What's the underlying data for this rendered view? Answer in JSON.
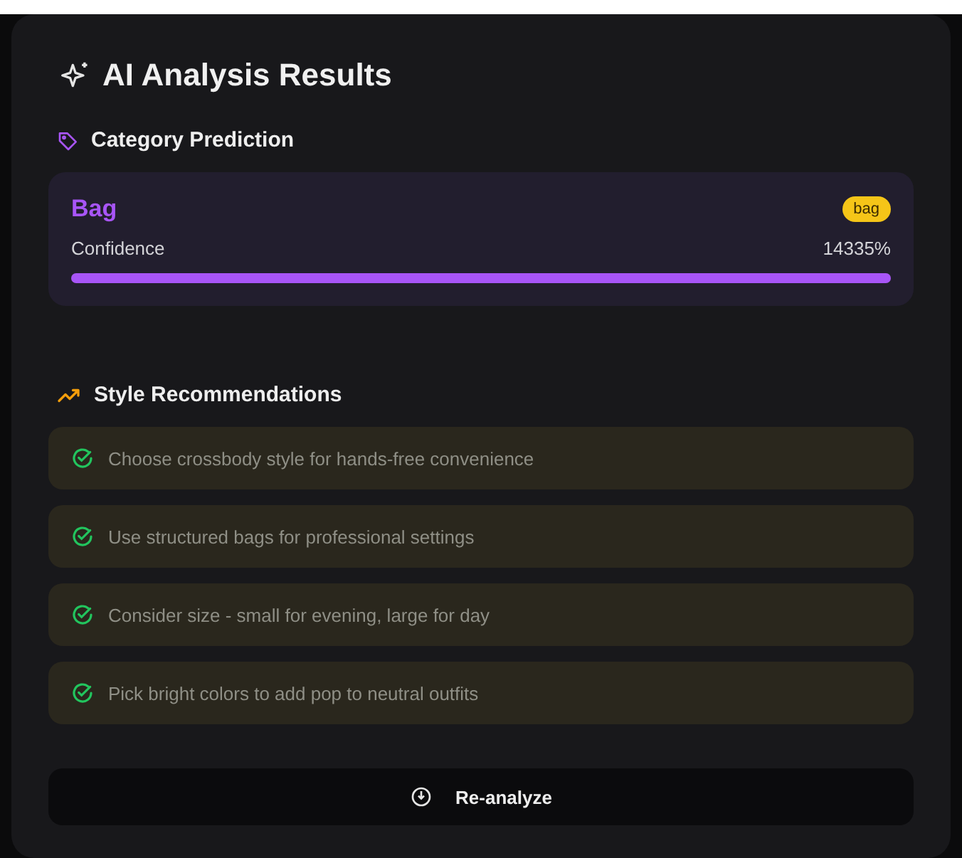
{
  "title": "AI Analysis Results",
  "category": {
    "heading": "Category Prediction",
    "name": "Bag",
    "badge": "bag",
    "confidence_label": "Confidence",
    "confidence_value": "14335%",
    "level": 1
  },
  "recommendations": {
    "heading": "Style Recommendations",
    "items": [
      {
        "text": "Choose crossbody style for hands-free convenience"
      },
      {
        "text": "Use structured bags for professional settings"
      },
      {
        "text": "Consider size - small for evening, large for day"
      },
      {
        "text": "Pick bright colors to add pop to neutral outfits"
      }
    ]
  },
  "button": {
    "label": "Re-analyze"
  }
}
